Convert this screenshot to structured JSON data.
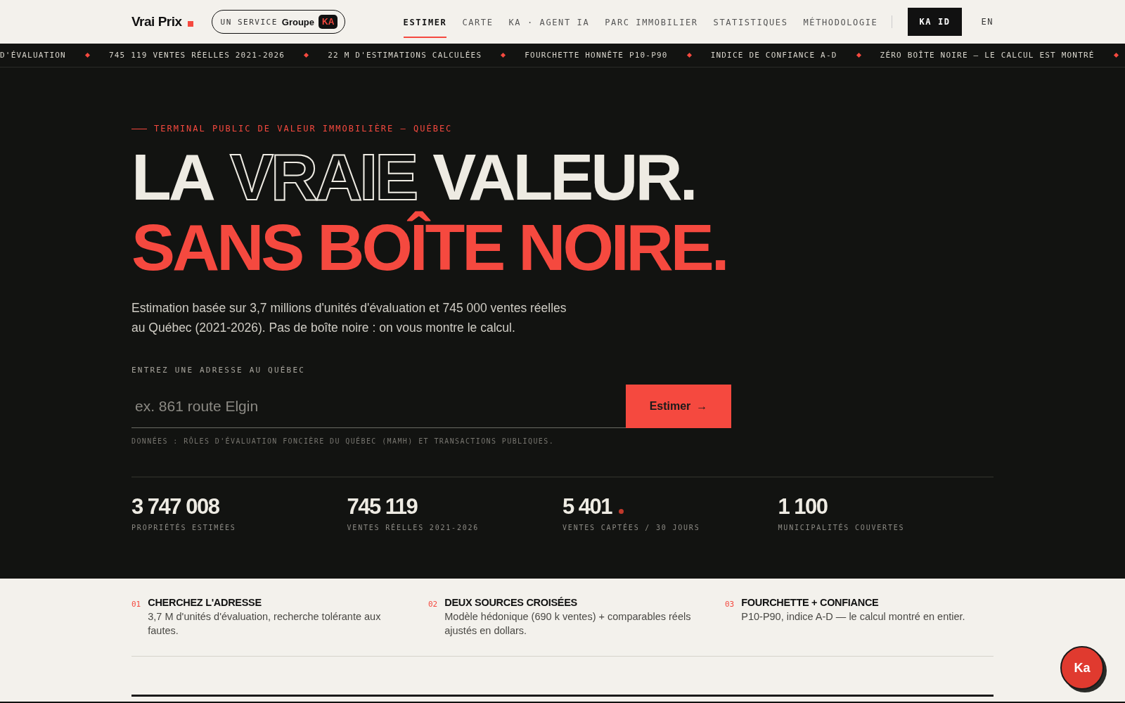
{
  "header": {
    "logo": "Vrai Prix",
    "service_badge": {
      "label": "UN SERVICE",
      "brand": "Groupe",
      "brand_mark": "KA"
    },
    "nav": [
      {
        "label": "ESTIMER",
        "selected": true
      },
      {
        "label": "CARTE",
        "selected": false
      },
      {
        "label": "KA · AGENT IA",
        "selected": false
      },
      {
        "label": "PARC IMMOBILIER",
        "selected": false
      },
      {
        "label": "STATISTIQUES",
        "selected": false
      },
      {
        "label": "MÉTHODOLOGIE",
        "selected": false
      }
    ],
    "id_button": "KA ID",
    "language": "EN"
  },
  "ticker": [
    "D'ÉVALUATION",
    "745 119 VENTES RÉELLES 2021-2026",
    "22 M D'ESTIMATIONS CALCULÉES",
    "FOURCHETTE HONNÊTE P10-P90",
    "INDICE DE CONFIANCE A-D",
    "ZÉRO BOÎTE NOIRE — LE CALCUL EST MONTRÉ"
  ],
  "hero": {
    "eyebrow": "TERMINAL PUBLIC DE VALEUR IMMOBILIÈRE — QUÉBEC",
    "title_line_1": [
      {
        "text": "LA",
        "kind": "solid"
      },
      {
        "text": "VRAIE",
        "kind": "outline"
      },
      {
        "text": "VALEUR.",
        "kind": "solid"
      }
    ],
    "title_line_2": "SANS BOÎTE NOIRE.",
    "lead": "Estimation basée sur 3,7 millions d'unités d'évaluation et 745 000 ventes réelles au Québec (2021-2026). Pas de boîte noire : on vous montre le calcul.",
    "address_label": "ENTREZ UNE ADRESSE AU QUÉBEC",
    "address_placeholder": "ex. 861 route Elgin",
    "submit": "Estimer",
    "arrow": "→",
    "source_note": "DONNÉES : RÔLES D'ÉVALUATION FONCIÈRE DU QUÉBEC (MAMH) ET TRANSACTIONS PUBLIQUES."
  },
  "stats": [
    {
      "value": "3 747 008",
      "label": "PROPRIÉTÉS ESTIMÉES",
      "live": false
    },
    {
      "value": "745 119",
      "label": "VENTES RÉELLES 2021-2026",
      "live": false
    },
    {
      "value": "5 401",
      "label": "VENTES CAPTÉES / 30 JOURS",
      "live": true
    },
    {
      "value": "1 100",
      "label": "MUNICIPALITÉS COUVERTES",
      "live": false
    }
  ],
  "steps": [
    {
      "number": "01",
      "title": "CHERCHEZ L'ADRESSE",
      "text": "3,7 M d'unités d'évaluation, recherche tolérante aux fautes."
    },
    {
      "number": "02",
      "title": "DEUX SOURCES CROISÉES",
      "text": "Modèle hédonique (690 k ventes) + comparables réels ajustés en dollars."
    },
    {
      "number": "03",
      "title": "FOURCHETTE + CONFIANCE",
      "text": "P10-P90, indice A-D — le calcul montré en entier."
    }
  ],
  "chat_button": "Ka"
}
